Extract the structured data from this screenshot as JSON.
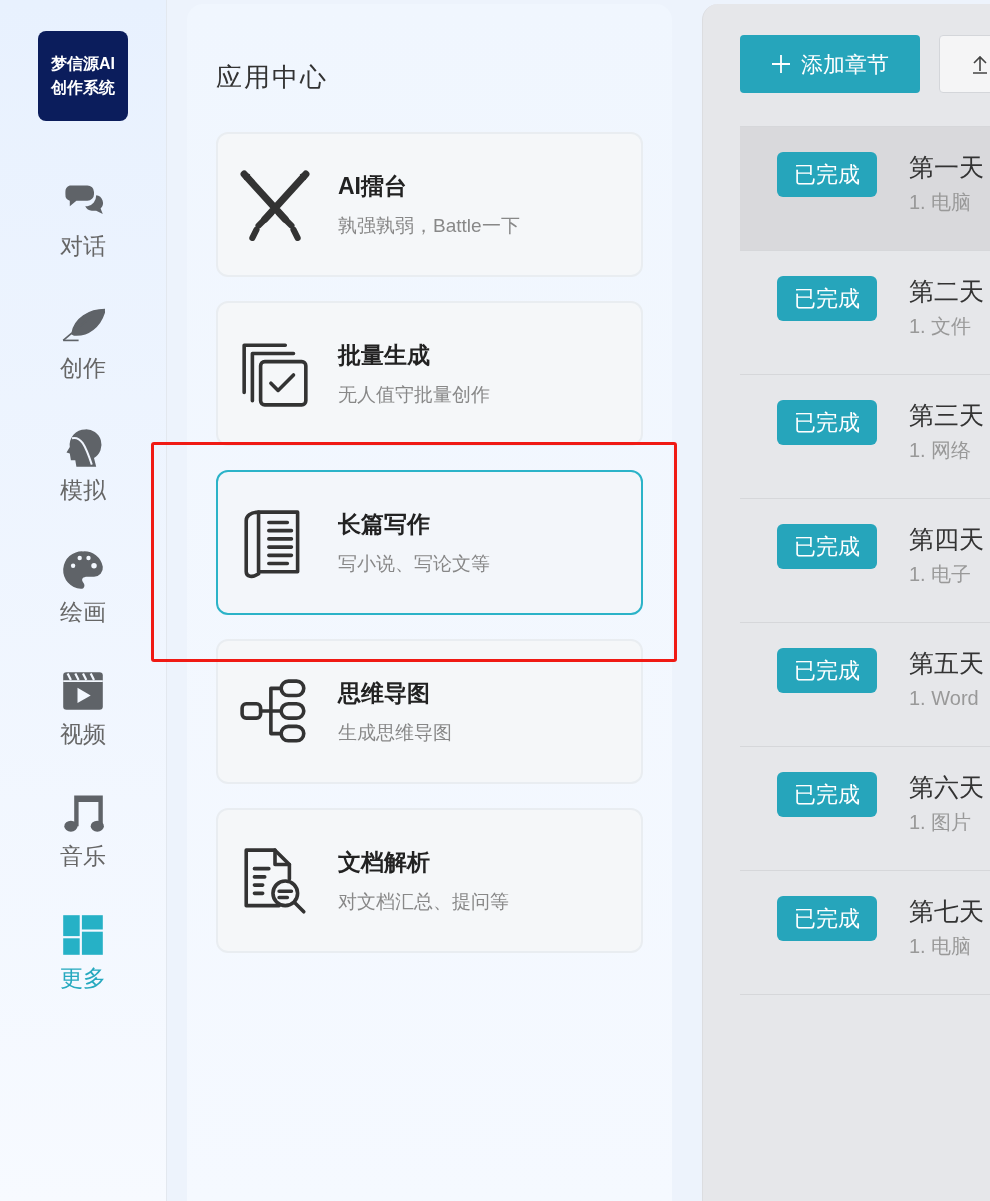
{
  "logo": {
    "lines": [
      "梦信源AI",
      "创作系统"
    ]
  },
  "nav": [
    {
      "label": "对话",
      "selected": false
    },
    {
      "label": "创作",
      "selected": false
    },
    {
      "label": "模拟",
      "selected": false
    },
    {
      "label": "绘画",
      "selected": false
    },
    {
      "label": "视频",
      "selected": false
    },
    {
      "label": "音乐",
      "selected": false
    },
    {
      "label": "更多",
      "selected": true
    }
  ],
  "app_center": {
    "title": "应用中心",
    "apps": [
      {
        "title": "AI擂台",
        "subtitle": "孰强孰弱，Battle一下",
        "selected": false,
        "highlighted": false
      },
      {
        "title": "批量生成",
        "subtitle": "无人值守批量创作",
        "selected": false,
        "highlighted": false
      },
      {
        "title": "长篇写作",
        "subtitle": "写小说、写论文等",
        "selected": true,
        "highlighted": true
      },
      {
        "title": "思维导图",
        "subtitle": "生成思维导图",
        "selected": false,
        "highlighted": false
      },
      {
        "title": "文档解析",
        "subtitle": "对文档汇总、提问等",
        "selected": false,
        "highlighted": false
      }
    ]
  },
  "chapters": {
    "add_button": "添加章节",
    "rows": [
      {
        "status": "已完成",
        "title": "第一天",
        "summary": "1. 电脑",
        "hovered": true
      },
      {
        "status": "已完成",
        "title": "第二天",
        "summary": "1. 文件",
        "hovered": false
      },
      {
        "status": "已完成",
        "title": "第三天",
        "summary": "1. 网络",
        "hovered": false
      },
      {
        "status": "已完成",
        "title": "第四天",
        "summary": "1. 电子",
        "hovered": false
      },
      {
        "status": "已完成",
        "title": "第五天",
        "summary": "1. Word",
        "hovered": false
      },
      {
        "status": "已完成",
        "title": "第六天",
        "summary": "1. 图片",
        "hovered": false
      },
      {
        "status": "已完成",
        "title": "第七天",
        "summary": "1. 电脑",
        "hovered": false
      }
    ]
  }
}
